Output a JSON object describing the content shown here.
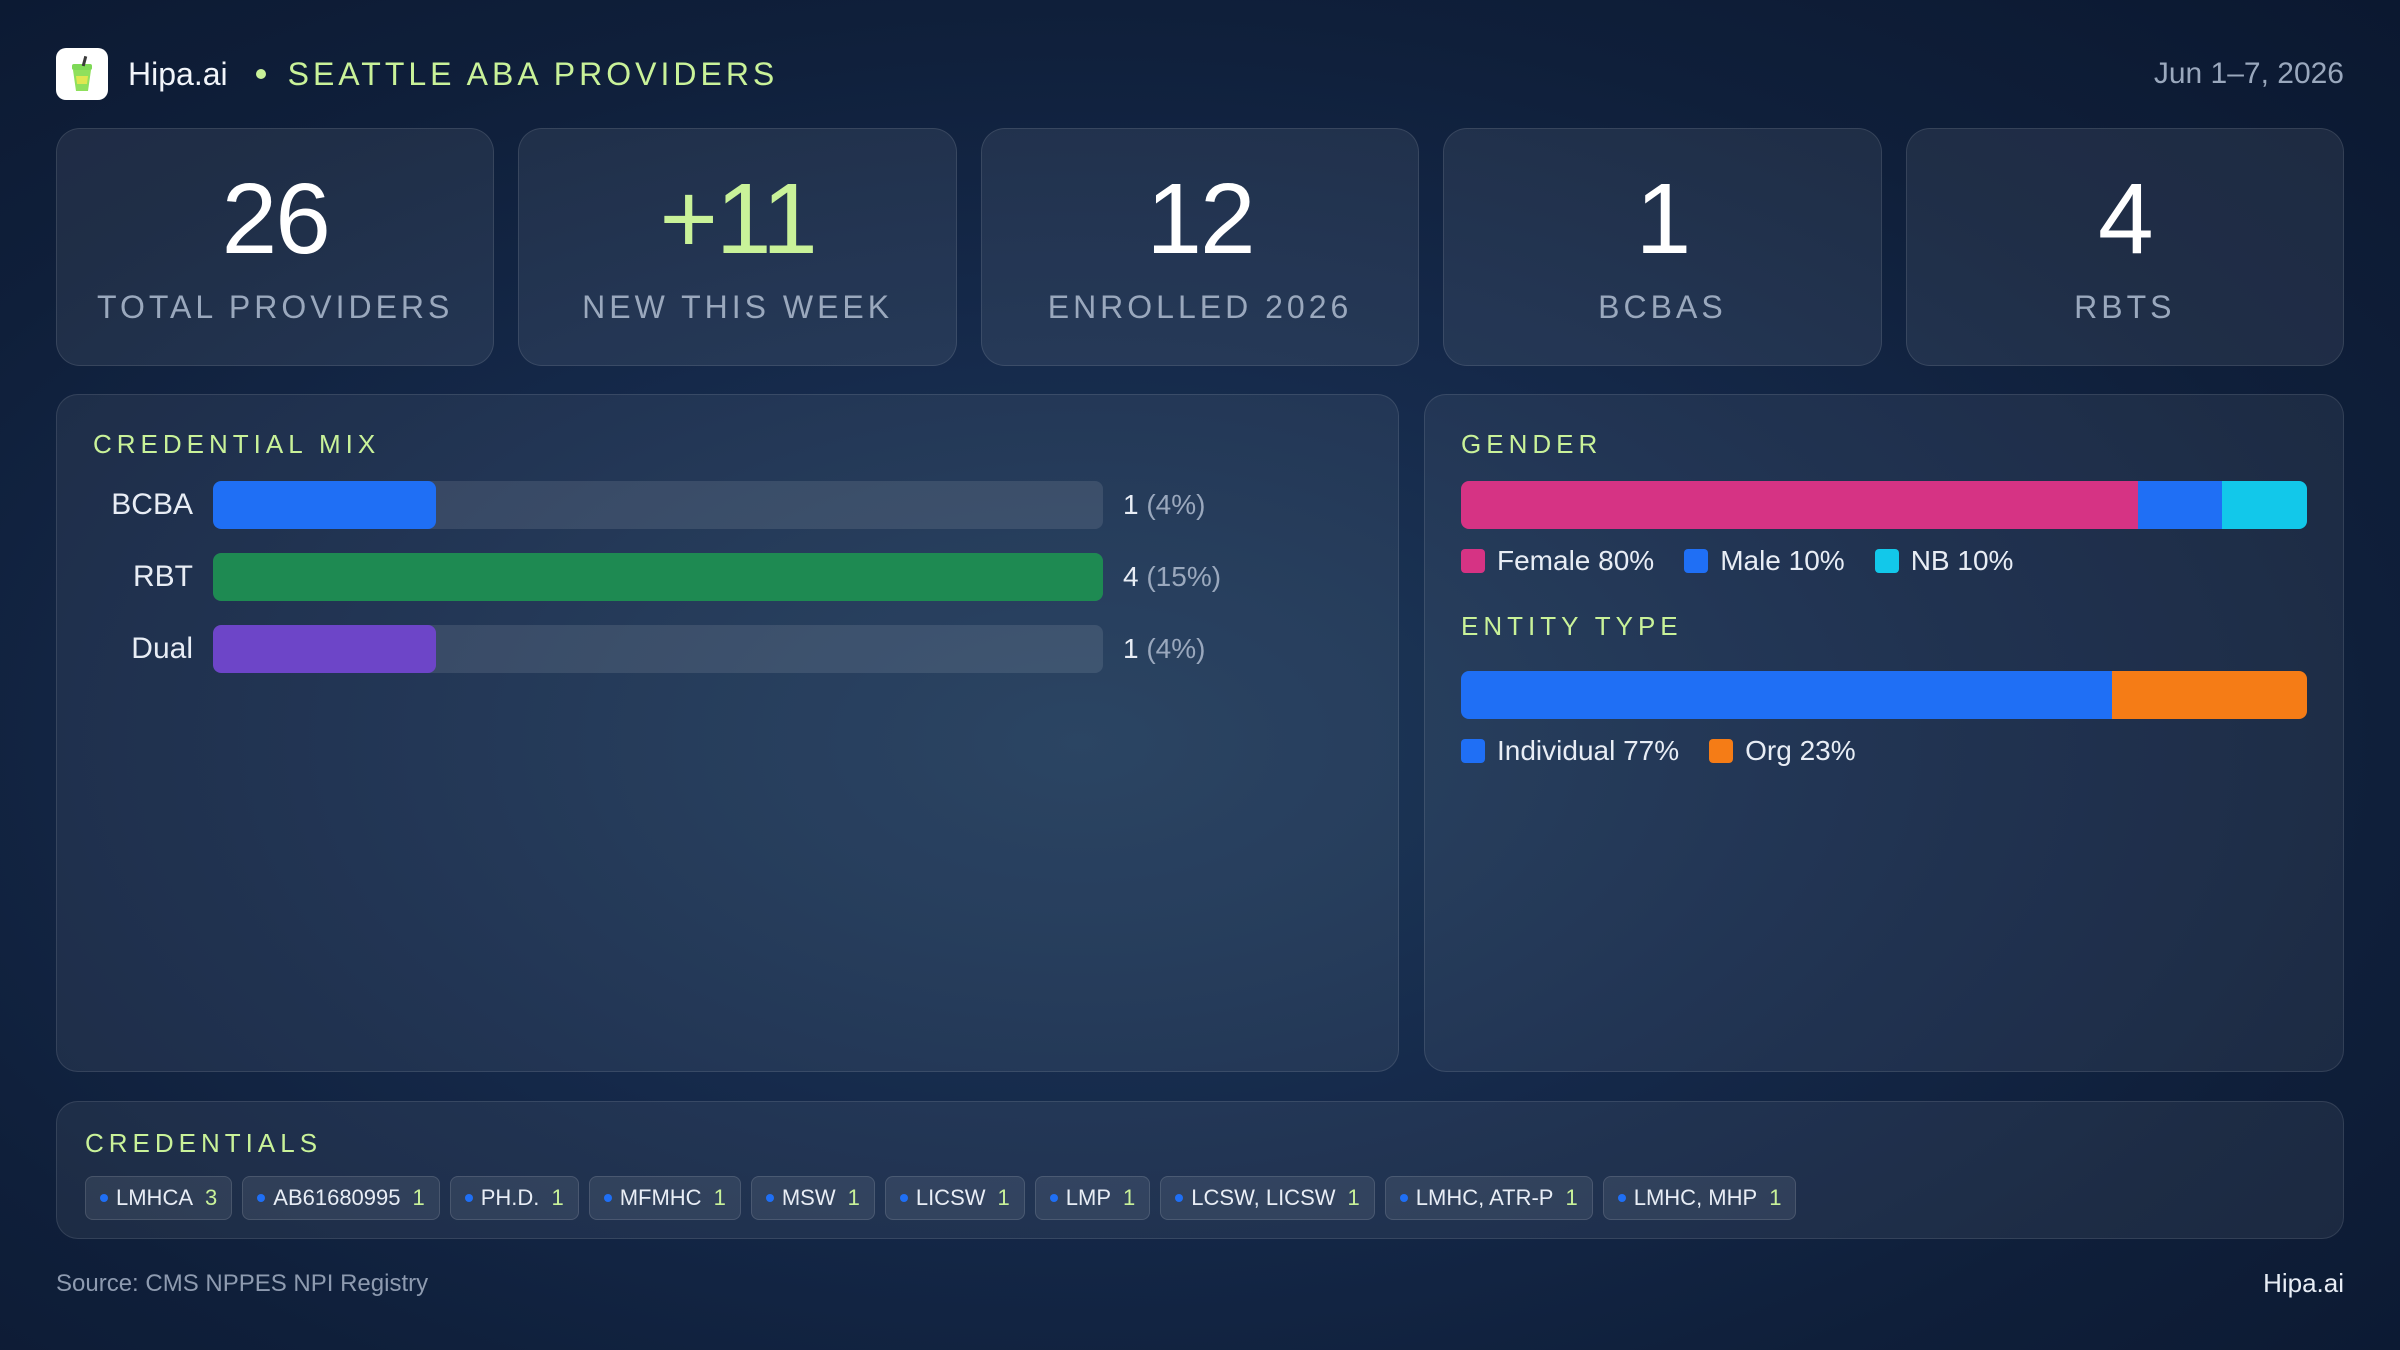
{
  "header": {
    "brand": "Hipa.ai",
    "title": "SEATTLE ABA PROVIDERS",
    "date_range": "Jun 1–7, 2026",
    "logo_icon": "drink-cup-icon"
  },
  "stats": [
    {
      "value": "26",
      "label": "TOTAL PROVIDERS"
    },
    {
      "value": "+11",
      "label": "NEW THIS WEEK"
    },
    {
      "value": "12",
      "label": "ENROLLED 2026"
    },
    {
      "value": "1",
      "label": "BCBAS"
    },
    {
      "value": "4",
      "label": "RBTS"
    }
  ],
  "credential_mix": {
    "title": "CREDENTIAL MIX",
    "max": 4,
    "rows": [
      {
        "label": "BCBA",
        "count": 1,
        "count_text": "1",
        "pct_text": "(4%)",
        "color": "#1f6ff5"
      },
      {
        "label": "RBT",
        "count": 4,
        "count_text": "4",
        "pct_text": "(15%)",
        "color": "#1e8a52"
      },
      {
        "label": "Dual",
        "count": 1,
        "count_text": "1",
        "pct_text": "(4%)",
        "color": "#6d45c8"
      }
    ]
  },
  "gender": {
    "title": "GENDER",
    "segments": [
      {
        "label": "Female 80%",
        "value": 80,
        "color": "#d63384"
      },
      {
        "label": "Male 10%",
        "value": 10,
        "color": "#1f6ff5"
      },
      {
        "label": "NB 10%",
        "value": 10,
        "color": "#12c8ea"
      }
    ]
  },
  "entity_type": {
    "title": "ENTITY TYPE",
    "segments": [
      {
        "label": "Individual 77%",
        "value": 77,
        "color": "#1f6ff5"
      },
      {
        "label": "Org 23%",
        "value": 23,
        "color": "#f57c16"
      }
    ]
  },
  "credentials": {
    "title": "CREDENTIALS",
    "chips": [
      {
        "name": "LMHCA",
        "count": "3"
      },
      {
        "name": "AB61680995",
        "count": "1"
      },
      {
        "name": "PH.D.",
        "count": "1"
      },
      {
        "name": "MFMHC",
        "count": "1"
      },
      {
        "name": "MSW",
        "count": "1"
      },
      {
        "name": "LICSW",
        "count": "1"
      },
      {
        "name": "LMP",
        "count": "1"
      },
      {
        "name": "LCSW, LICSW",
        "count": "1"
      },
      {
        "name": "LMHC, ATR-P",
        "count": "1"
      },
      {
        "name": "LMHC, MHP",
        "count": "1"
      }
    ]
  },
  "footer": {
    "source": "Source: CMS NPPES NPI Registry",
    "brand": "Hipa.ai"
  }
}
